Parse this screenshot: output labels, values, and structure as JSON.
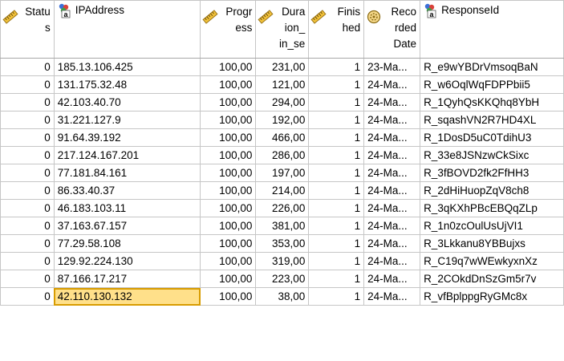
{
  "columns": [
    {
      "key": "status",
      "header_lines": [
        "Statu",
        "s"
      ],
      "icon": "scale-icon",
      "align": "right"
    },
    {
      "key": "ip",
      "header_lines": [
        "IPAddress"
      ],
      "icon": "nominal-icon",
      "align": "left"
    },
    {
      "key": "progress",
      "header_lines": [
        "Progr",
        "ess"
      ],
      "icon": "scale-icon",
      "align": "right"
    },
    {
      "key": "duration",
      "header_lines": [
        "Dura",
        "ion_",
        "in_se"
      ],
      "icon": "scale-icon",
      "align": "right"
    },
    {
      "key": "finished",
      "header_lines": [
        "Finis",
        "hed"
      ],
      "icon": "scale-icon",
      "align": "right"
    },
    {
      "key": "recorded",
      "header_lines": [
        "Reco",
        "rded",
        "Date"
      ],
      "icon": "date-icon",
      "align": "left"
    },
    {
      "key": "responseid",
      "header_lines": [
        "ResponseId"
      ],
      "icon": "nominal-icon",
      "align": "left"
    }
  ],
  "rows": [
    [
      "0",
      "185.13.106.425",
      "100,00",
      "231,00",
      "1",
      "23-Ma...",
      "R_e9wYBDrVmsoqBaN"
    ],
    [
      "0",
      "131.175.32.48",
      "100,00",
      "121,00",
      "1",
      "24-Ma...",
      "R_w6OqlWqFDPPbii5"
    ],
    [
      "0",
      "42.103.40.70",
      "100,00",
      "294,00",
      "1",
      "24-Ma...",
      "R_1QyhQsKKQhq8YbH"
    ],
    [
      "0",
      "31.221.127.9",
      "100,00",
      "192,00",
      "1",
      "24-Ma...",
      "R_sqashVN2R7HD4XL"
    ],
    [
      "0",
      "91.64.39.192",
      "100,00",
      "466,00",
      "1",
      "24-Ma...",
      "R_1DosD5uC0TdihU3"
    ],
    [
      "0",
      "217.124.167.201",
      "100,00",
      "286,00",
      "1",
      "24-Ma...",
      "R_33e8JSNzwCkSixc"
    ],
    [
      "0",
      "77.181.84.161",
      "100,00",
      "197,00",
      "1",
      "24-Ma...",
      "R_3fBOVD2fk2FfHH3"
    ],
    [
      "0",
      "86.33.40.37",
      "100,00",
      "214,00",
      "1",
      "24-Ma...",
      "R_2dHiHuopZqV8ch8"
    ],
    [
      "0",
      "46.183.103.11",
      "100,00",
      "226,00",
      "1",
      "24-Ma...",
      "R_3qKXhPBcEBQqZLp"
    ],
    [
      "0",
      "37.163.67.157",
      "100,00",
      "381,00",
      "1",
      "24-Ma...",
      "R_1n0zcOulUsUjVI1"
    ],
    [
      "0",
      "77.29.58.108",
      "100,00",
      "353,00",
      "1",
      "24-Ma...",
      "R_3Lkkanu8YBBujxs"
    ],
    [
      "0",
      "129.92.224.130",
      "100,00",
      "319,00",
      "1",
      "24-Ma...",
      "R_C19q7wWEwkyxnXz"
    ],
    [
      "0",
      "87.166.17.217",
      "100,00",
      "223,00",
      "1",
      "24-Ma...",
      "R_2COkdDnSzGm5r7v"
    ],
    [
      "0",
      "42.110.130.132",
      "100,00",
      "38,00",
      "1",
      "24-Ma...",
      "R_vfBplppgRyGMc8x"
    ]
  ],
  "selected": {
    "row": 13,
    "col": 1
  },
  "colors": {
    "selected_cell": "#ffe08a",
    "grid_line": "#c6c6c6"
  }
}
